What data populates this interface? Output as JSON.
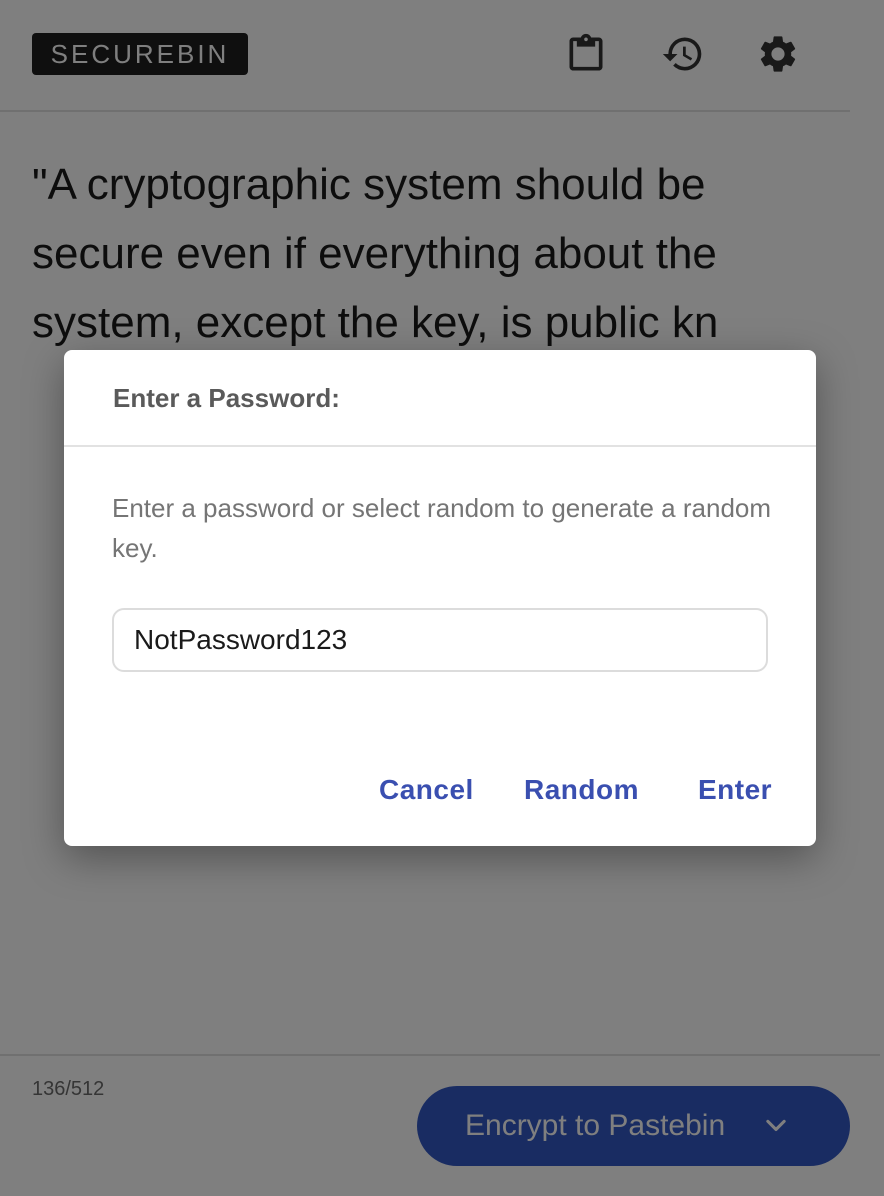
{
  "app": {
    "logo_text": "SECUREBIN",
    "header_icons": [
      "clipboard-icon",
      "history-icon",
      "gear-icon"
    ]
  },
  "editor": {
    "text": "\"A cryptographic system should be secure even if everything about the system, except the key, is public kn",
    "char_count": "136/512"
  },
  "actions": {
    "encrypt_label": "Encrypt to Pastebin",
    "encrypt_icon": "chevron-down-icon"
  },
  "dialog": {
    "title": "Enter a Password:",
    "message": "Enter a password or select random to generate a random key.",
    "password_value": "NotPassword123",
    "cancel_label": "Cancel",
    "random_label": "Random",
    "enter_label": "Enter"
  },
  "colors": {
    "accent": "#3a4fb0",
    "primary_button": "#3358c4",
    "logo_background": "#1f1f1f",
    "overlay": "rgba(0,0,0,0.5)"
  }
}
